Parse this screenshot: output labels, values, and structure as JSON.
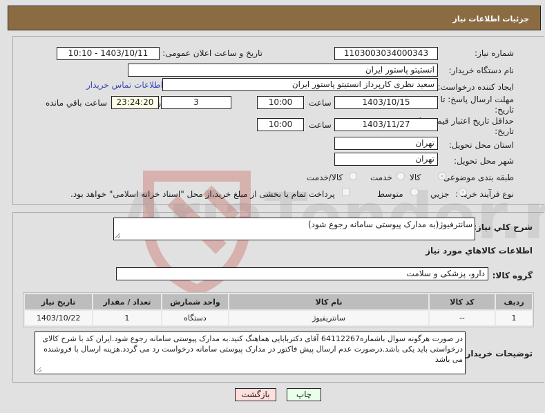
{
  "header": {
    "title": "جزئیات اطلاعات نیاز"
  },
  "form": {
    "need_number": {
      "label": "شماره نیاز:",
      "value": "1103003034000343"
    },
    "announce_datetime": {
      "label": "تاریخ و ساعت اعلان عمومی:",
      "value": "1403/10/11 - 10:10"
    },
    "buyer_org": {
      "label": "نام دستگاه خریدار:",
      "value": "انستیتو پاستور ایران"
    },
    "creator": {
      "label": "ایجاد کننده درخواست:",
      "value": "سعید نظری کارپرداز انستیتو پاستور ایران"
    },
    "buyer_contact_link": "اطلاعات تماس خریدار",
    "reply_deadline": {
      "label_line1": "مهلت ارسال پاسخ: تا",
      "label_line2": "تاریخ:",
      "date": "1403/10/15",
      "time_label": "ساعت",
      "time": "10:00",
      "days": "3",
      "days_label": "روز و",
      "remaining": "23:24:20",
      "remaining_label": "ساعت باقي مانده"
    },
    "price_validity": {
      "label_line1": "حداقل تاریخ اعتبار قیمت: تا",
      "label_line2": "تاریخ:",
      "date": "1403/11/27",
      "time_label": "ساعت",
      "time": "10:00"
    },
    "delivery_province": {
      "label": "استان محل تحویل:",
      "value": "تهران"
    },
    "delivery_city": {
      "label": "شهر محل تحویل:",
      "value": "تهران"
    },
    "category": {
      "label": "طبقه بندی موضوعی:",
      "options": [
        "کالا",
        "خدمت",
        "کالا/خدمت"
      ],
      "selected": "کالا"
    },
    "purchase_type": {
      "label": "نوع فرآیند خرید :",
      "options": [
        "جزیي",
        "متوسط"
      ],
      "selected": "جزیي",
      "treasury_checkbox_label": "پرداخت تمام یا بخشی از مبلغ خرید،از محل \"اسناد خزانه اسلامی\" خواهد بود.",
      "treasury_checked": false
    }
  },
  "details": {
    "general_desc": {
      "label": "شرح كلي نياز:",
      "value": "سانترفیوژ(به مدارک پیوستی سامانه رجوع شود)"
    },
    "items_section_title": "اطلاعات كالاهاي مورد نياز",
    "goods_group": {
      "label": "گروه کالا:",
      "value": "دارو، پزشکی و سلامت"
    },
    "table": {
      "headers": [
        "ردیف",
        "کد کالا",
        "نام کالا",
        "واحد شمارش",
        "تعداد / مقدار",
        "تاریخ نیاز"
      ],
      "rows": [
        [
          "1",
          "--",
          "سانتریفیوژ",
          "دستگاه",
          "1",
          "1403/10/22"
        ]
      ]
    },
    "buyer_notes": {
      "label": "توضیحات خریدار:",
      "value": "در صورت هرگونه سوال باشماره64112267 آقای دکتربابایی هماهنگ کنید.به مدارک پیوستی سامانه رجوع شود.ایران کد با شرح کالای درخواستی باید یکی باشد.درصورت عدم ارسال پیش فاکتور در مدارک پیوستی سامانه درخواست رد می گردد.هزینه ارسال با فروشنده می باشد"
    }
  },
  "buttons": {
    "print": "چاپ",
    "back": "بازگشت"
  },
  "watermark": {
    "text": "AriaTender.neT"
  },
  "colors": {
    "header_bg": "#8b6c42",
    "link": "#3b47b5",
    "print_bg": "#eaffea",
    "back_bg": "#ffdede",
    "watermark": "#d9a3a3"
  }
}
